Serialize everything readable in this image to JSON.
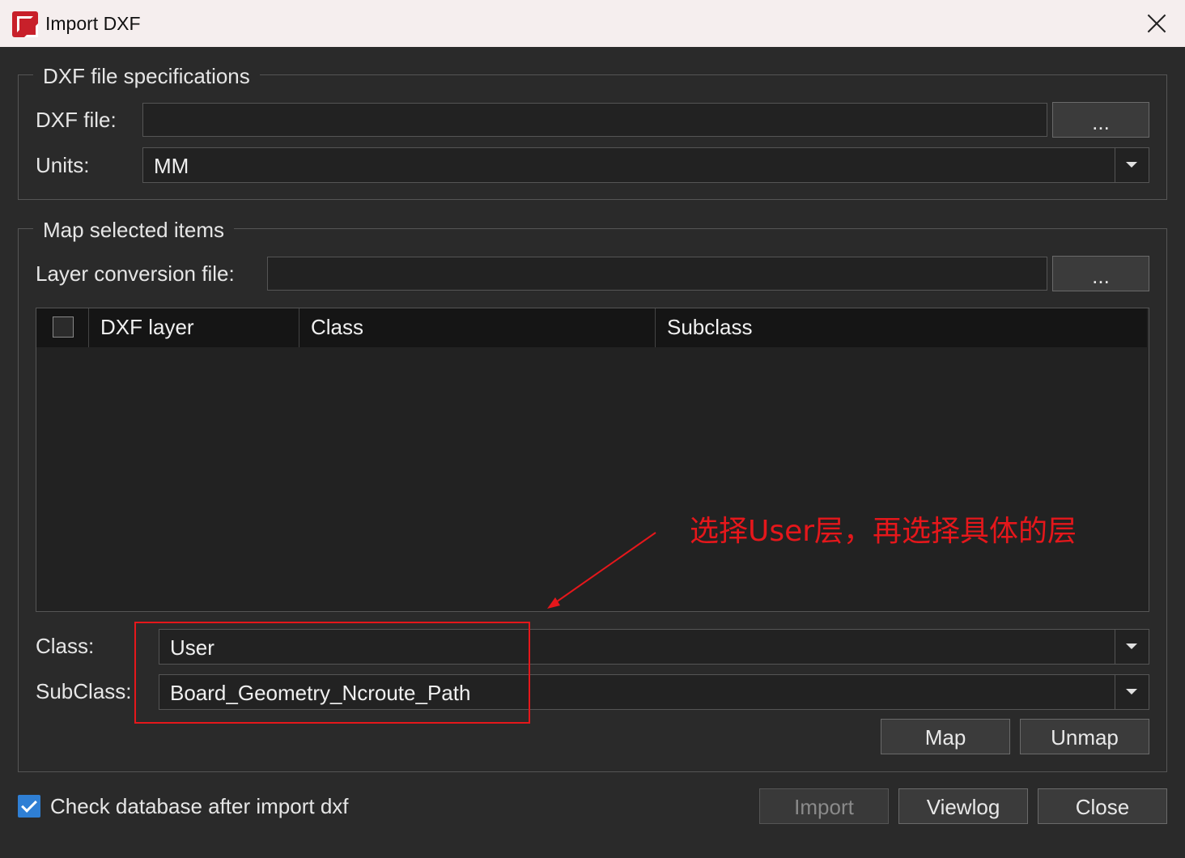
{
  "window": {
    "title": "Import DXF"
  },
  "file_specs": {
    "legend": "DXF file specifications",
    "dxf_file_label": "DXF file:",
    "dxf_file_value": "",
    "browse_label": "...",
    "units_label": "Units:",
    "units_value": "MM"
  },
  "map_items": {
    "legend": "Map selected items",
    "layer_file_label": "Layer conversion file:",
    "layer_file_value": "",
    "browse_label": "...",
    "table": {
      "columns": [
        "DXF layer",
        "Class",
        "Subclass"
      ],
      "rows": []
    },
    "class_label": "Class:",
    "class_value": "User",
    "subclass_label": "SubClass:",
    "subclass_value": "Board_Geometry_Ncroute_Path",
    "map_button": "Map",
    "unmap_button": "Unmap"
  },
  "footer": {
    "check_database_label": "Check database after import dxf",
    "check_database_checked": true,
    "import_button": "Import",
    "viewlog_button": "Viewlog",
    "close_button": "Close"
  },
  "annotation": {
    "text": "选择User层，再选择具体的层",
    "color": "#e5171b"
  },
  "colors": {
    "background": "#2a2a2a",
    "titlebar": "#f5eeee",
    "accent_blue": "#2f7fd4",
    "annotation_red": "#e5171b"
  }
}
